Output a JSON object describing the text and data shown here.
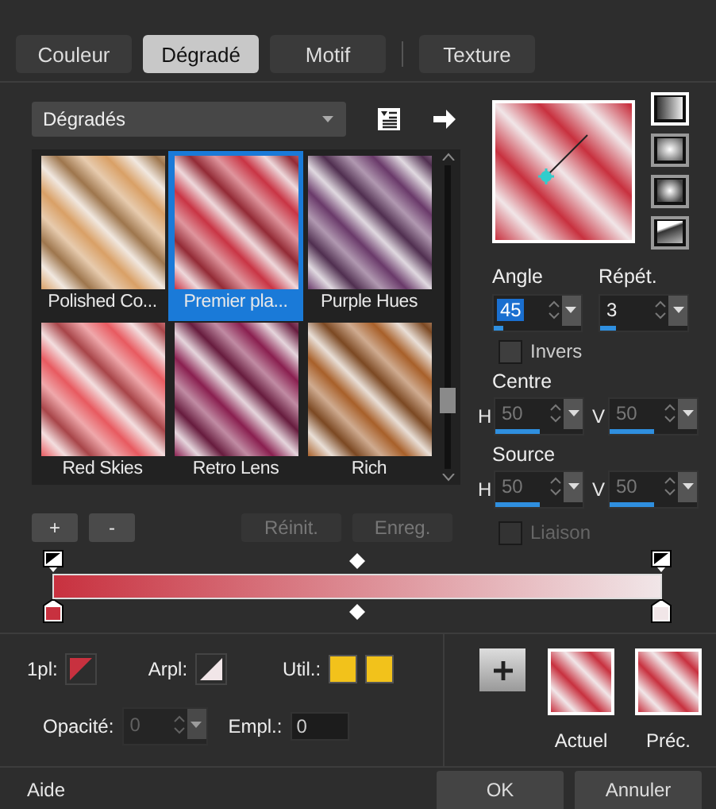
{
  "tabs": [
    {
      "label": "Couleur",
      "selected": false
    },
    {
      "label": "Dégradé",
      "selected": true
    },
    {
      "label": "Motif",
      "selected": false
    },
    {
      "label": "Texture",
      "selected": false
    }
  ],
  "category": {
    "value": "Dégradés"
  },
  "presets": [
    {
      "name": "Polished Co...",
      "selected": false,
      "color": "#d9a066"
    },
    {
      "name": "Premier pla...",
      "selected": true,
      "color": "#c93545"
    },
    {
      "name": "Purple Hues",
      "selected": false,
      "color": "#6a3a6a"
    },
    {
      "name": "Red Skies",
      "selected": false,
      "color": "#e85a60"
    },
    {
      "name": "Retro Lens",
      "selected": false,
      "color": "#8a2050"
    },
    {
      "name": "Rich",
      "selected": false,
      "color": "#a8602a"
    }
  ],
  "preset_buttons": [
    {
      "label": "+",
      "disabled": false
    },
    {
      "label": "-",
      "disabled": false
    },
    {
      "label": "Réinit.",
      "disabled": true
    },
    {
      "label": "Enreg.",
      "disabled": true
    }
  ],
  "gradient": {
    "stops": [
      {
        "color": "#c8313f"
      },
      {
        "color": "#f1e6e8"
      }
    ]
  },
  "styles": [
    {
      "selected": true
    },
    {
      "selected": false
    },
    {
      "selected": false
    },
    {
      "selected": false
    }
  ],
  "angle": {
    "label": "Angle",
    "value": "45",
    "highlighted": true,
    "level": 0.1
  },
  "repeat": {
    "label": "Répét.",
    "value": "3",
    "highlighted": false,
    "level": 0.18
  },
  "invert": {
    "label": "Invers",
    "checked": false
  },
  "center": {
    "label": "Centre",
    "disabled": true,
    "h": {
      "label": "H",
      "value": "50",
      "level": 0.5
    },
    "v": {
      "label": "V",
      "value": "50",
      "level": 0.5
    }
  },
  "source": {
    "label": "Source",
    "disabled": true,
    "h": {
      "label": "H",
      "value": "50",
      "level": 0.5
    },
    "v": {
      "label": "V",
      "value": "50",
      "level": 0.5
    }
  },
  "link": {
    "label": "Liaison",
    "checked": false,
    "disabled": true
  },
  "foreground": {
    "label": "1pl:"
  },
  "background": {
    "label": "Arpl:"
  },
  "user": {
    "label": "Util.:",
    "swatches": [
      {
        "color": "#f2c21b"
      },
      {
        "color": "#f2c21b"
      }
    ]
  },
  "opacity": {
    "label": "Opacité:",
    "value": "0",
    "disabled": true
  },
  "location": {
    "label": "Empl.:",
    "value": "0"
  },
  "current": {
    "label": "Actuel"
  },
  "previous": {
    "label": "Préc."
  },
  "footer": {
    "help": "Aide",
    "buttons": [
      "OK",
      "Annuler"
    ]
  }
}
